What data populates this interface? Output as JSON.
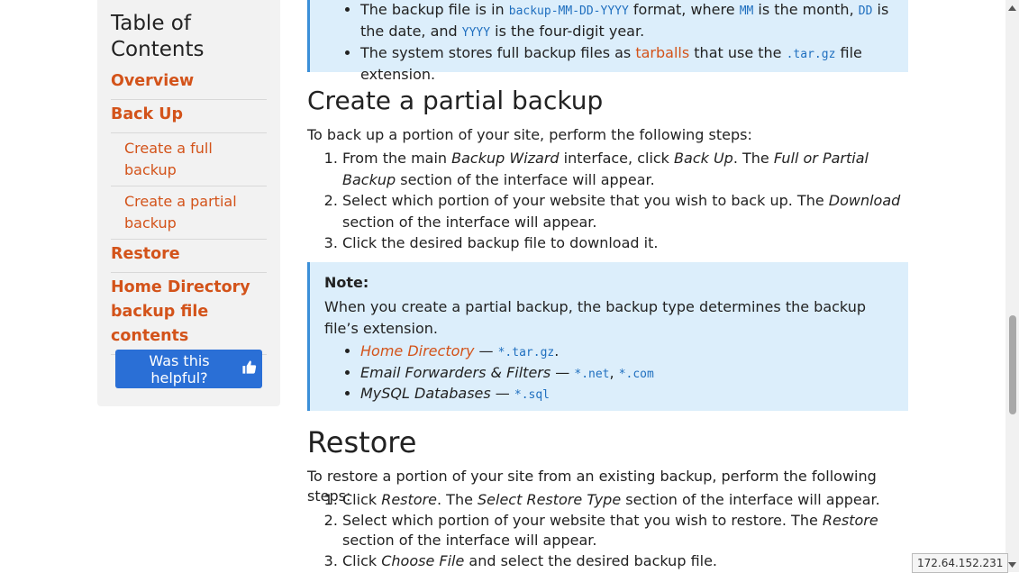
{
  "toc": {
    "title": "Table of Contents",
    "items": [
      {
        "label": "Overview"
      },
      {
        "label": "Back Up"
      },
      {
        "label": "Create a full backup"
      },
      {
        "label": "Create a partial backup"
      },
      {
        "label": "Restore"
      },
      {
        "label": "Home Directory backup file contents"
      }
    ],
    "helpful_label": "Was this helpful?"
  },
  "top_callout": {
    "b1_pre": "The backup file is in ",
    "b1_code1": "backup-MM-DD-YYYY",
    "b1_mid1": " format, where ",
    "b1_code2": "MM",
    "b1_mid2": " is the month, ",
    "b1_code3": "DD",
    "b1_mid3": " is the date, and ",
    "b1_code4": "YYYY",
    "b1_end": " is the four-digit year.",
    "b2_pre": "The system stores full backup files as ",
    "b2_link": "tarballs",
    "b2_mid": " that use the ",
    "b2_code": ".tar.gz",
    "b2_end": " file extension."
  },
  "partial": {
    "heading": "Create a partial backup",
    "intro": "To back up a portion of your site, perform the following steps:",
    "s1_a": "From the main ",
    "s1_em1": "Backup Wizard",
    "s1_b": " interface, click ",
    "s1_em2": "Back Up",
    "s1_c": ". The ",
    "s1_em3": "Full or Partial Backup",
    "s1_d": " section of the interface will appear.",
    "s2_a": "Select which portion of your website that you wish to back up. The ",
    "s2_em": "Download",
    "s2_b": " section of the interface will appear.",
    "s3": "Click the desired backup file to download it."
  },
  "note": {
    "title": "Note:",
    "body": "When you create a partial backup, the backup type determines the backup file’s extension.",
    "i1_link": "Home Directory",
    "i1_dash": " — ",
    "i1_code": "*.tar.gz",
    "i1_end": ".",
    "i2_em": "Email Forwarders & Filters",
    "i2_dash": " — ",
    "i2_code1": "*.net",
    "i2_sep": ", ",
    "i2_code2": "*.com",
    "i3_em": "MySQL Databases",
    "i3_dash": " — ",
    "i3_code": "*.sql"
  },
  "restore": {
    "heading": "Restore",
    "intro": "To restore a portion of your site from an existing backup, perform the following steps:",
    "s1_a": "Click ",
    "s1_em1": "Restore",
    "s1_b": ". The ",
    "s1_em2": "Select Restore Type",
    "s1_c": " section of the interface will appear.",
    "s2_a": "Select which portion of your website that you wish to restore. The ",
    "s2_em": "Restore",
    "s2_b": " section of the interface will appear.",
    "s3_a": "Click ",
    "s3_em": "Choose File",
    "s3_b": " and select the desired backup file."
  },
  "status": {
    "ip": "172.64.152.231"
  },
  "colors": {
    "accent": "#d3531a",
    "button": "#2a6fd6",
    "callout_bg": "#dceefb",
    "callout_border": "#3c8fd8",
    "code": "#1f6fbf"
  }
}
